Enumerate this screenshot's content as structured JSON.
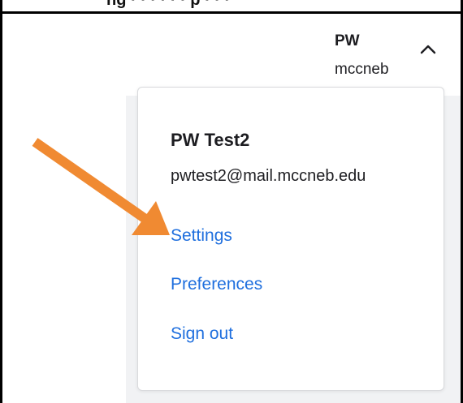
{
  "colors": {
    "link": "#1f6fde",
    "text": "#1d1d21",
    "annotation_arrow": "#f08a32",
    "page_background": "#f1f2f4"
  },
  "account": {
    "initials": "PW",
    "org": "mccneb",
    "toggle_icon": "chevron-up-icon"
  },
  "dropdown": {
    "user_name": "PW Test2",
    "email": "pwtest2@mail.mccneb.edu",
    "links": {
      "settings": "Settings",
      "preferences": "Preferences",
      "sign_out": "Sign out"
    }
  },
  "annotation": {
    "type": "arrow",
    "points_to": "settings"
  }
}
